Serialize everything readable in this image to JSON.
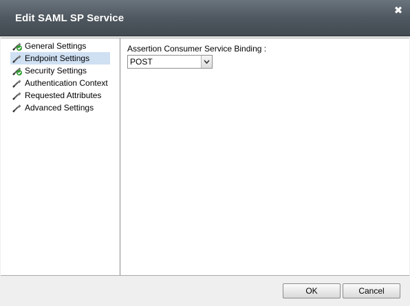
{
  "dialog": {
    "title": "Edit SAML SP Service",
    "close_glyph": "✖"
  },
  "nav": {
    "items": [
      {
        "label": "General Settings",
        "icon": "check-cable-icon",
        "selected": false
      },
      {
        "label": "Endpoint Settings",
        "icon": "cable-icon",
        "selected": true
      },
      {
        "label": "Security Settings",
        "icon": "check-cable-icon",
        "selected": false
      },
      {
        "label": "Authentication Context",
        "icon": "cable-icon",
        "selected": false
      },
      {
        "label": "Requested Attributes",
        "icon": "cable-icon",
        "selected": false
      },
      {
        "label": "Advanced Settings",
        "icon": "cable-icon",
        "selected": false
      }
    ]
  },
  "main": {
    "binding_label": "Assertion Consumer Service Binding :",
    "binding_value": "POST"
  },
  "footer": {
    "ok_label": "OK",
    "cancel_label": "Cancel"
  },
  "colors": {
    "titlebar": "#4f5860",
    "selected_row": "#cfe0f3",
    "check_green": "#2f9b2f"
  }
}
